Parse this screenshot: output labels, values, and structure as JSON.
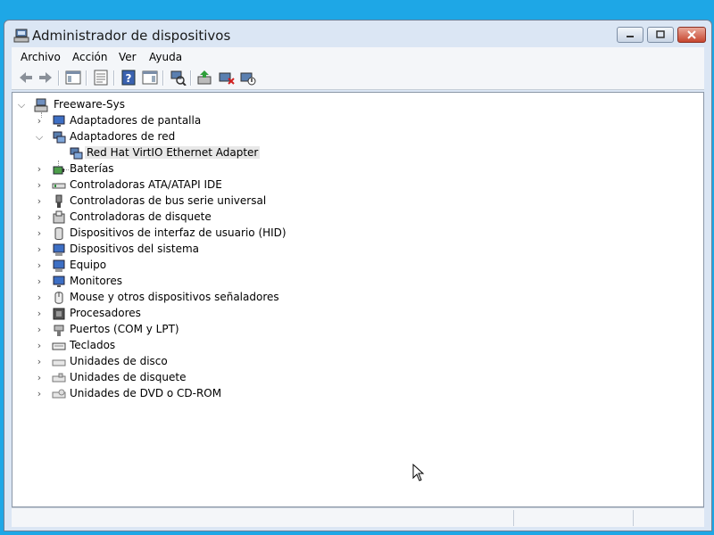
{
  "window": {
    "title": "Administrador de dispositivos",
    "icon": "device-manager-icon"
  },
  "menu": {
    "items": [
      "Archivo",
      "Acción",
      "Ver",
      "Ayuda"
    ]
  },
  "toolbar": {
    "buttons": [
      "back-icon",
      "forward-icon",
      "show-hide-tree-icon",
      "properties-icon",
      "help-icon",
      "view-icon",
      "scan-hardware-icon",
      "update-driver-icon",
      "uninstall-icon",
      "disable-icon"
    ]
  },
  "tree": {
    "root": "Freeware-Sys",
    "categories": [
      {
        "label": "Adaptadores de pantalla",
        "icon": "monitor-icon",
        "expanded": false
      },
      {
        "label": "Adaptadores de red",
        "icon": "network-adapter-icon",
        "expanded": true,
        "children": [
          {
            "label": "Red Hat VirtIO Ethernet Adapter",
            "icon": "network-card-icon"
          }
        ]
      },
      {
        "label": "Baterías",
        "icon": "battery-icon",
        "expanded": false
      },
      {
        "label": "Controladoras ATA/ATAPI IDE",
        "icon": "ide-controller-icon",
        "expanded": false
      },
      {
        "label": "Controladoras de bus serie universal",
        "icon": "usb-icon",
        "expanded": false
      },
      {
        "label": "Controladoras de disquete",
        "icon": "floppy-controller-icon",
        "expanded": false
      },
      {
        "label": "Dispositivos de interfaz de usuario (HID)",
        "icon": "hid-icon",
        "expanded": false
      },
      {
        "label": "Dispositivos del sistema",
        "icon": "system-devices-icon",
        "expanded": false
      },
      {
        "label": "Equipo",
        "icon": "computer-icon",
        "expanded": false
      },
      {
        "label": "Monitores",
        "icon": "monitor-icon",
        "expanded": false
      },
      {
        "label": "Mouse y otros dispositivos señaladores",
        "icon": "mouse-icon",
        "expanded": false
      },
      {
        "label": "Procesadores",
        "icon": "processor-icon",
        "expanded": false
      },
      {
        "label": "Puertos (COM y LPT)",
        "icon": "port-icon",
        "expanded": false
      },
      {
        "label": "Teclados",
        "icon": "keyboard-icon",
        "expanded": false
      },
      {
        "label": "Unidades de disco",
        "icon": "disk-drive-icon",
        "expanded": false
      },
      {
        "label": "Unidades de disquete",
        "icon": "floppy-drive-icon",
        "expanded": false
      },
      {
        "label": "Unidades de DVD o CD-ROM",
        "icon": "dvd-drive-icon",
        "expanded": false
      }
    ]
  },
  "colors": {
    "desktop": "#1ea7e6",
    "window_frame": "#dbe6f4",
    "close_button": "#c7462f"
  }
}
